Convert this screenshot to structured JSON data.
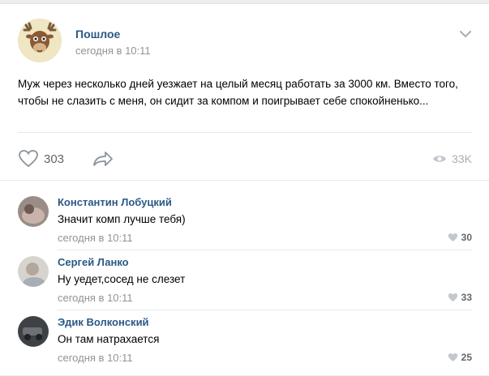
{
  "post": {
    "author": "Пошлое",
    "time": "сегодня в 10:11",
    "text": "Муж через несколько дней уезжает на целый месяц работать за 3000 км. Вместо того, чтобы не слазить с меня, он сидит за компом и поигрывает себе спокойненько...",
    "likes": "303",
    "views": "33K"
  },
  "comments": [
    {
      "name": "Константин Лобуцкий",
      "text": "Значит комп лучше тебя)",
      "time": "сегодня в 10:11",
      "likes": "30"
    },
    {
      "name": "Сергей Ланко",
      "text": "Ну уедет,сосед не слезет",
      "time": "сегодня в 10:11",
      "likes": "33"
    },
    {
      "name": "Эдик Волконский",
      "text": "Он там натрахается",
      "time": "сегодня в 10:11",
      "likes": "25"
    }
  ],
  "colors": {
    "link": "#2a5885",
    "meta": "#939393",
    "icon": "#a8adb3"
  },
  "icons": [
    "moose-avatar",
    "chevron-down-icon",
    "heart-icon",
    "share-icon",
    "eye-icon"
  ]
}
